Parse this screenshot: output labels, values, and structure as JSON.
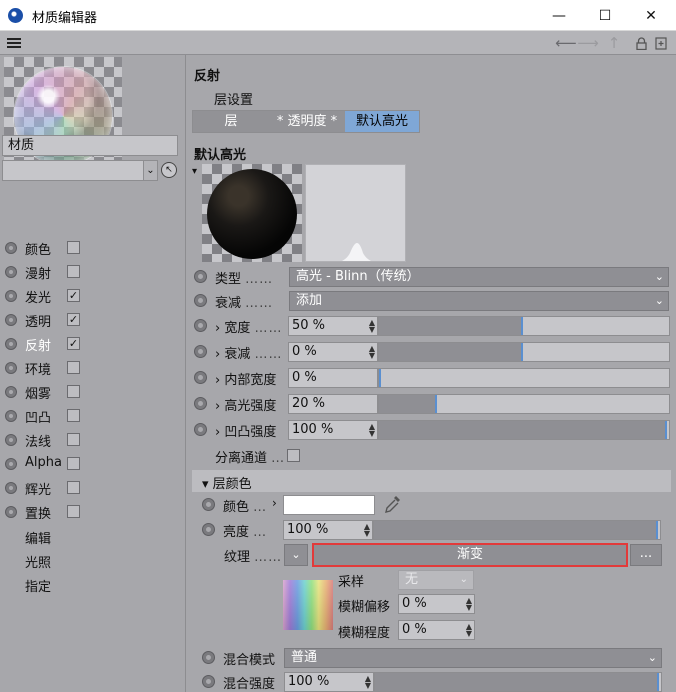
{
  "window": {
    "title": "材质编辑器",
    "minimize": "—",
    "maximize": "☐",
    "close": "✕"
  },
  "toolbar": {
    "menu_icon": "hamburger-icon",
    "back_icon": "arrow-left-icon",
    "forward_icon": "arrow-right-icon",
    "up_icon": "arrow-up-icon",
    "lock_icon": "lock-icon",
    "new_icon": "new-panel-icon"
  },
  "material": {
    "name": "材质"
  },
  "channels": [
    {
      "label": "颜色",
      "checked": false,
      "active": false
    },
    {
      "label": "漫射",
      "checked": false,
      "active": false
    },
    {
      "label": "发光",
      "checked": true,
      "active": false
    },
    {
      "label": "透明",
      "checked": true,
      "active": false
    },
    {
      "label": "反射",
      "checked": true,
      "active": true
    },
    {
      "label": "环境",
      "checked": false,
      "active": false
    },
    {
      "label": "烟雾",
      "checked": false,
      "active": false
    },
    {
      "label": "凹凸",
      "checked": false,
      "active": false
    },
    {
      "label": "法线",
      "checked": false,
      "active": false
    },
    {
      "label": "Alpha",
      "checked": false,
      "active": false
    },
    {
      "label": "辉光",
      "checked": false,
      "active": false
    },
    {
      "label": "置换",
      "checked": false,
      "active": false
    }
  ],
  "extra_items": [
    "编辑",
    "光照",
    "指定"
  ],
  "reflect": {
    "title": "反射",
    "layer_settings": "层设置",
    "tabs": [
      {
        "label": "层",
        "selected": false
      },
      {
        "label": "* 透明度 *",
        "selected": false
      },
      {
        "label": "默认高光",
        "selected": true
      }
    ],
    "section_title": "默认高光"
  },
  "params": {
    "type": {
      "label": "类型",
      "dots": "……",
      "value": "高光 - Blinn（传统）"
    },
    "falloff": {
      "label": "衰减",
      "dots": "……",
      "value": "添加"
    },
    "width": {
      "label": "宽度",
      "dots": "……",
      "value": "50 %",
      "fraction": 0.5
    },
    "decay": {
      "label": "衰减",
      "dots": "……",
      "value": "0 %",
      "fraction": 0.5
    },
    "inner_width": {
      "label": "内部宽度",
      "value": "0 %",
      "fraction": 0.0
    },
    "spec_strength": {
      "label": "高光强度",
      "value": "20 %",
      "fraction": 0.2
    },
    "bump_strength": {
      "label": "凹凸强度",
      "value": "100 %",
      "fraction": 1.0
    },
    "separate_pass": {
      "label": "分离通道",
      "dots": "…",
      "checked": false
    }
  },
  "layer_color": {
    "title": "层颜色",
    "color": {
      "label": "颜色",
      "dots": "…",
      "value": "#ffffff"
    },
    "brightness": {
      "label": "亮度",
      "dots": "…",
      "value": "100 %",
      "fraction": 1.0
    },
    "texture": {
      "label": "纹理",
      "dots": "……",
      "shader": "渐变",
      "more": "..."
    },
    "sampling": {
      "label": "采样",
      "value": "无"
    },
    "blur_offset": {
      "label": "模糊偏移",
      "value": "0 %"
    },
    "blur_scale": {
      "label": "模糊程度",
      "value": "0 %"
    },
    "blend_mode": {
      "label": "混合模式",
      "value": "普通"
    },
    "blend_strength": {
      "label": "混合强度",
      "value": "100 %",
      "fraction": 1.0
    }
  },
  "colors": {
    "accent_tab": "#7fa7d6",
    "highlight_border": "#e23a3a",
    "panel_bg": "#a7a7ab"
  }
}
